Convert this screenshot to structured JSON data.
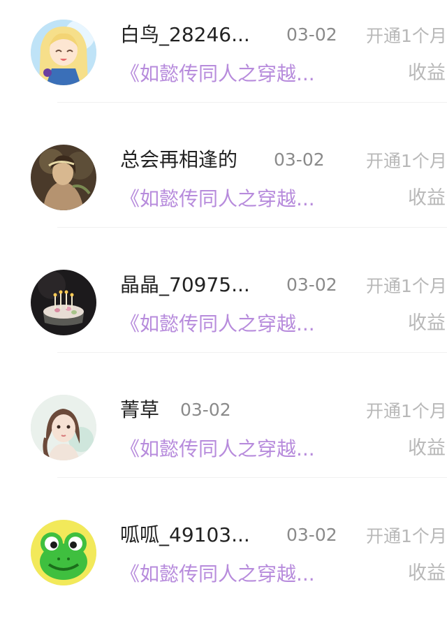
{
  "list": {
    "items": [
      {
        "name": "白鸟_28246...",
        "date": "03-02",
        "book": "《如懿传同人之穿越...",
        "action": "开通1个月",
        "income": "收益"
      },
      {
        "name": "总会再相逢的",
        "date": "03-02",
        "book": "《如懿传同人之穿越...",
        "action": "开通1个月",
        "income": "收益"
      },
      {
        "name": "晶晶_70975...",
        "date": "03-02",
        "book": "《如懿传同人之穿越...",
        "action": "开通1个月",
        "income": "收益"
      },
      {
        "name": "菁草",
        "date": "03-02",
        "book": "《如懿传同人之穿越...",
        "action": "开通1个月",
        "income": "收益"
      },
      {
        "name": "呱呱_49103...",
        "date": "03-02",
        "book": "《如懿传同人之穿越...",
        "action": "开通1个月",
        "income": "收益"
      }
    ]
  },
  "colors": {
    "name": "#222222",
    "date": "#8a8a8a",
    "book": "#b78bdc",
    "muted": "#b8b8b8",
    "divider": "#f0f0f0"
  }
}
